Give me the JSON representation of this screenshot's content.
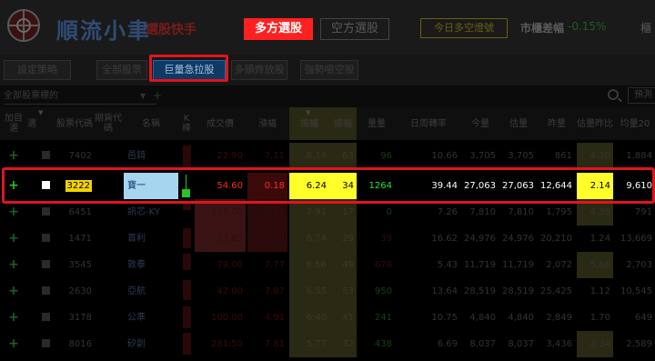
{
  "header": {
    "brand": "順流小聿",
    "brand_sub": "選股快手",
    "long_btn": "多方選股",
    "short_btn": "空方選股",
    "today_btn": "今日多空燈號",
    "market_label": "市櫃差幅",
    "market_value": "-0.15%",
    "cut_text": "櫃"
  },
  "toolbar": {
    "settings": "設定策略",
    "all": "全部股票",
    "surge": "巨量急拉股",
    "multi": "多頭齊放股",
    "strong": "強勢噴空股"
  },
  "filter": {
    "select_value": "全部股票標的",
    "plus": "+",
    "forecast_btn": "預測"
  },
  "table": {
    "headers": {
      "join": "加目選",
      "selected": "選",
      "sort_mark": "▼",
      "code": "股票代碼",
      "futures": "期貨代碼",
      "name": "名稱",
      "k": "K棒",
      "price": "成交價",
      "change": "漲幅",
      "amp": "振幅",
      "amp_sort": "▼",
      "swing": "振幅",
      "vol": "量量",
      "turnover": "日周轉率",
      "today": "今量",
      "est": "估量",
      "yday": "昨量",
      "est_ratio": "估量昨比",
      "avg20": "均量20"
    },
    "rows": [
      {
        "plus": "+",
        "code": "7402",
        "name": "邑錡",
        "price": "22.90",
        "change": "7.11",
        "amp": "8.14",
        "swing": "63",
        "vol": "96",
        "turnover": "10.66",
        "today": "3,705",
        "est": "3,705",
        "yday": "861",
        "ratio": "4.30",
        "avg20": "1,884"
      },
      {
        "plus": "+",
        "code": "3222",
        "name": "寶一",
        "price": "54.60",
        "change": "0.18",
        "amp": "6.24",
        "swing": "34",
        "vol": "1264",
        "turnover": "39.44",
        "today": "27,063",
        "est": "27,063",
        "yday": "12,644",
        "ratio": "2.14",
        "avg20": "9,610"
      },
      {
        "plus": "+",
        "code": "6451",
        "name": "訊芯-KY",
        "price": "118.00",
        "change": "8.77",
        "amp": "7.91",
        "swing": "17",
        "vol": "0",
        "turnover": "7.26",
        "today": "7,810",
        "est": "7,810",
        "yday": "1,795",
        "ratio": "4.35",
        "avg20": "791"
      },
      {
        "plus": "+",
        "code": "1471",
        "name": "首利",
        "price": "23.65",
        "change": "10.00",
        "amp": "6.74",
        "swing": "29",
        "vol": "39",
        "turnover": "16.62",
        "today": "24,976",
        "est": "24,976",
        "yday": "20,210",
        "ratio": "1.24",
        "avg20": "13,669"
      },
      {
        "plus": "+",
        "code": "3545",
        "name": "敦泰",
        "price": "79.00",
        "change": "7.77",
        "amp": "6.66",
        "swing": "49",
        "vol": "678",
        "turnover": "5.43",
        "today": "11,719",
        "est": "11,719",
        "yday": "2,072",
        "ratio": "5.66",
        "avg20": "2,703"
      },
      {
        "plus": "+",
        "code": "2630",
        "name": "亞航",
        "price": "42.00",
        "change": "7.87",
        "amp": "6.55",
        "swing": "53",
        "vol": "950",
        "turnover": "13.64",
        "today": "28,519",
        "est": "28,519",
        "yday": "25,425",
        "ratio": "1.12",
        "avg20": "10,545"
      },
      {
        "plus": "+",
        "code": "3178",
        "name": "公準",
        "price": "100.00",
        "change": "4.91",
        "amp": "6.40",
        "swing": "41",
        "vol": "241",
        "turnover": "10.75",
        "today": "4,840",
        "est": "4,840",
        "yday": "2,849",
        "ratio": "1.70",
        "avg20": "649"
      },
      {
        "plus": "+",
        "code": "8016",
        "name": "矽創",
        "price": "281.50",
        "change": "7.81",
        "amp": "5.77",
        "swing": "32",
        "vol": "438",
        "turnover": "6.69",
        "today": "8,037",
        "est": "8,037",
        "yday": "3,436",
        "ratio": "2.34",
        "avg20": "2,589"
      }
    ]
  },
  "colors": {
    "accent_red": "#ff2020",
    "highlight_outline": "#e0151c",
    "selected_code_bg": "#f2d300",
    "selected_name_bg": "#a6d5f0",
    "yellow_cell": "#ffff2a"
  }
}
